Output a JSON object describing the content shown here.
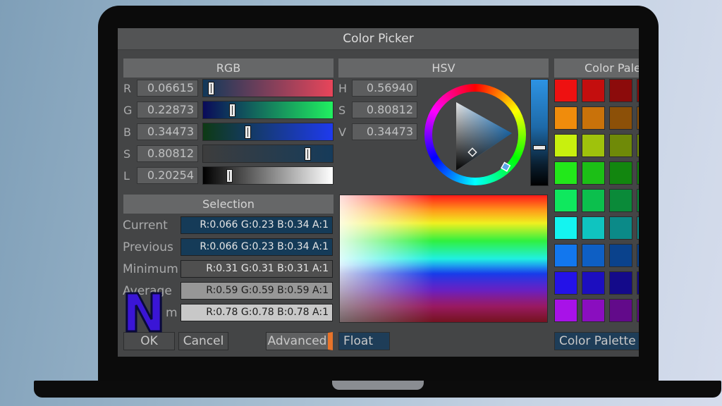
{
  "window": {
    "title": "Color Picker"
  },
  "rgb_panel": {
    "header": "RGB",
    "rows": [
      {
        "label": "R",
        "value": "0.06615",
        "slider": 0.06615
      },
      {
        "label": "G",
        "value": "0.22873",
        "slider": 0.22873
      },
      {
        "label": "B",
        "value": "0.34473",
        "slider": 0.34473
      },
      {
        "label": "S",
        "value": "0.80812",
        "slider": 0.80812
      },
      {
        "label": "L",
        "value": "0.20254",
        "slider": 0.20254
      }
    ]
  },
  "hsv_panel": {
    "header": "HSV",
    "rows": [
      {
        "label": "H",
        "value": "0.56940"
      },
      {
        "label": "S",
        "value": "0.80812"
      },
      {
        "label": "V",
        "value": "0.34473"
      }
    ],
    "value_bar_level": 0.34473
  },
  "palette_panel": {
    "header": "Color Pale",
    "colors": [
      [
        "#ee1111",
        "#c40e0e",
        "#8c0b0b"
      ],
      [
        "#f08c0c",
        "#c9720a",
        "#8c5008"
      ],
      [
        "#c8f00e",
        "#9fc20c",
        "#6f8a08"
      ],
      [
        "#22e81a",
        "#1cbf16",
        "#12860f"
      ],
      [
        "#0fe85e",
        "#0cbf4d",
        "#0a8a39"
      ],
      [
        "#14f4f0",
        "#0fc4c0",
        "#0b8a88"
      ],
      [
        "#1277ee",
        "#0e5fc4",
        "#0a428c"
      ],
      [
        "#2412e8",
        "#1c0ebf",
        "#140a8a"
      ],
      [
        "#a812e8",
        "#8a0ebf",
        "#620a8a"
      ]
    ]
  },
  "selection": {
    "header": "Selection",
    "rows": [
      {
        "label": "Current",
        "value": "R:0.066 G:0.23 B:0.34 A:1",
        "bg": "#153b58"
      },
      {
        "label": "Previous",
        "value": "R:0.066 G:0.23 B:0.34 A:1",
        "bg": "#153b58"
      },
      {
        "label": "Minimum",
        "value": "R:0.31 G:0.31 B:0.31 A:1",
        "bg": "#4f4f4f"
      },
      {
        "label": "Average",
        "value": "R:0.59 G:0.59 B:0.59 A:1",
        "bg": "#979797"
      },
      {
        "label": "m",
        "value": "R:0.78 G:0.78 B:0.78 A:1",
        "bg": "#c8c8c8"
      }
    ]
  },
  "buttons": {
    "ok": "OK",
    "cancel": "Cancel",
    "advanced": "Advanced",
    "float": "Float",
    "color_palette": "Color Palette"
  },
  "logo": {
    "text": "N",
    "color": "#3a15d6"
  },
  "colors": {
    "accent_orange": "#e8742a",
    "current_color": "#11395a"
  }
}
